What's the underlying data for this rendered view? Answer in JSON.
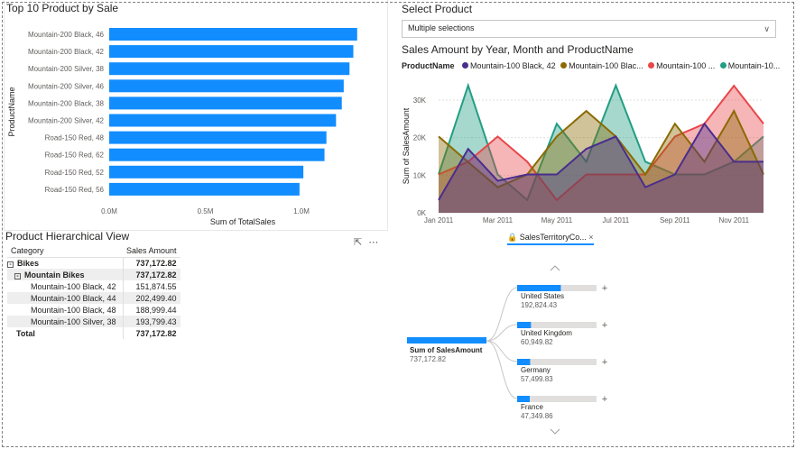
{
  "colors": {
    "bar": "#118dff",
    "series": [
      "#4a2e8c",
      "#8b6a00",
      "#e8474a",
      "#229e84"
    ],
    "grid": "#e1dfdd",
    "axis_text": "#605e5c"
  },
  "bar_chart": {
    "title": "Top 10 Product by Sale",
    "ylabel": "ProductName",
    "xlabel": "Sum of TotalSales",
    "ticks": [
      "0.0M",
      "0.5M",
      "1.0M"
    ]
  },
  "slicer": {
    "title": "Select Product",
    "value": "Multiple selections",
    "chevron": "chevron-down-icon"
  },
  "area_chart": {
    "title": "Sales Amount by Year, Month and ProductName",
    "legend_label": "ProductName",
    "legend_items": [
      "Mountain-100 Black, 42",
      "Mountain-100 Blac...",
      "Mountain-100 ...",
      "Mountain-10..."
    ],
    "ylabel": "Sum of SalesAmount",
    "yticks": [
      "0K",
      "10K",
      "20K",
      "30K"
    ],
    "xticks": [
      "Jan 2011",
      "Mar 2011",
      "May 2011",
      "Jul 2011",
      "Sep 2011",
      "Nov 2011"
    ]
  },
  "matrix": {
    "title": "Product Hierarchical View",
    "col1": "Category",
    "col2": "Sales Amount",
    "rows": [
      {
        "label": "Bikes",
        "value": "737,172.82",
        "level": 0,
        "expander": "⊟"
      },
      {
        "label": "Mountain Bikes",
        "value": "737,172.82",
        "level": 1,
        "expander": "⊟"
      },
      {
        "label": "Mountain-100 Black, 42",
        "value": "151,874.55",
        "level": 2,
        "expander": ""
      },
      {
        "label": "Mountain-100 Black, 44",
        "value": "202,499.40",
        "level": 2,
        "expander": ""
      },
      {
        "label": "Mountain-100 Black, 48",
        "value": "188,999.44",
        "level": 2,
        "expander": ""
      },
      {
        "label": "Mountain-100 Silver, 38",
        "value": "193,799.43",
        "level": 2,
        "expander": ""
      },
      {
        "label": "Total",
        "value": "737,172.82",
        "level": 3,
        "expander": ""
      }
    ]
  },
  "decomposition": {
    "filter_chip": "SalesTerritoryCo...",
    "filter_close": "×",
    "more_icon": "⋯",
    "root_label": "Sum of SalesAmount",
    "root_value": "737,172.82",
    "nodes": [
      {
        "label": "United States",
        "value": "192,824.43",
        "fraction": 0.262
      },
      {
        "label": "United Kingdom",
        "value": "60,949.82",
        "fraction": 0.083
      },
      {
        "label": "Germany",
        "value": "57,499.83",
        "fraction": 0.078
      },
      {
        "label": "France",
        "value": "47,349.86",
        "fraction": 0.064
      }
    ]
  },
  "chart_data": [
    {
      "type": "bar",
      "orientation": "horizontal",
      "title": "Top 10 Product by Sale",
      "xlabel": "Sum of TotalSales",
      "ylabel": "ProductName",
      "xlim": [
        0,
        1300000
      ],
      "categories": [
        "Mountain-200 Black, 46",
        "Mountain-200 Black, 42",
        "Mountain-200 Silver, 38",
        "Mountain-200 Silver, 46",
        "Mountain-200 Black, 38",
        "Mountain-200 Silver, 42",
        "Road-150 Red, 48",
        "Road-150 Red, 62",
        "Road-150 Red, 52",
        "Road-150 Red, 56"
      ],
      "values": [
        1290000,
        1270000,
        1250000,
        1220000,
        1210000,
        1180000,
        1130000,
        1120000,
        1010000,
        990000
      ]
    },
    {
      "type": "area",
      "title": "Sales Amount by Year, Month and ProductName",
      "ylabel": "Sum of SalesAmount",
      "ylim": [
        0,
        36000
      ],
      "x": [
        "Jan 2011",
        "Feb 2011",
        "Mar 2011",
        "Apr 2011",
        "May 2011",
        "Jun 2011",
        "Jul 2011",
        "Aug 2011",
        "Sep 2011",
        "Oct 2011",
        "Nov 2011",
        "Dec 2011"
      ],
      "series": [
        {
          "name": "Mountain-100 Black, 42",
          "values": [
            3400,
            17000,
            8500,
            10200,
            10200,
            17000,
            20300,
            6800,
            10200,
            23700,
            13600,
            13600
          ]
        },
        {
          "name": "Mountain-100 Blac...",
          "values": [
            20300,
            13500,
            6800,
            10200,
            20300,
            27100,
            20300,
            10200,
            23700,
            13600,
            27100,
            10200
          ]
        },
        {
          "name": "Mountain-100 ...",
          "values": [
            10200,
            13600,
            20300,
            13600,
            3400,
            10200,
            10200,
            10200,
            20300,
            23700,
            33800,
            23700
          ]
        },
        {
          "name": "Mountain-10...",
          "values": [
            10200,
            33900,
            10200,
            3400,
            23700,
            13600,
            33900,
            13600,
            10200,
            10200,
            13600,
            20300
          ]
        }
      ]
    }
  ]
}
